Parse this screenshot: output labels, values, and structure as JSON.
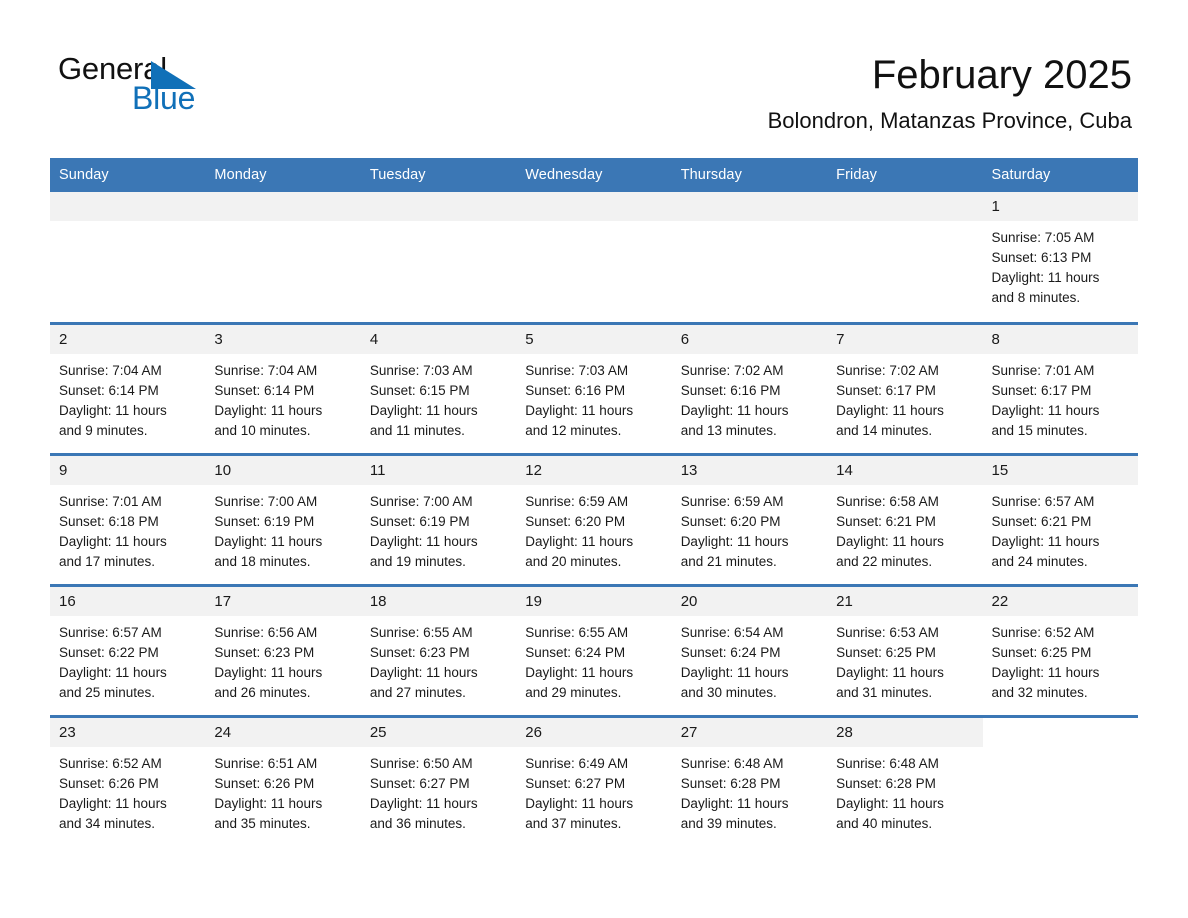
{
  "logo": {
    "word_one": "General",
    "word_two": "Blue",
    "triangle_icon": "blue-triangle-icon",
    "blue": "#1070b8"
  },
  "header": {
    "title": "February 2025",
    "subtitle": "Bolondron, Matanzas Province, Cuba"
  },
  "colors": {
    "header_blue": "#3b77b5",
    "row_divider_blue": "#3b77b5",
    "daynum_gray": "#f2f2f2",
    "text": "#1a1a1a"
  },
  "weekday_headers": [
    "Sunday",
    "Monday",
    "Tuesday",
    "Wednesday",
    "Thursday",
    "Friday",
    "Saturday"
  ],
  "weeks": [
    [
      {
        "day": "",
        "sunrise": "",
        "sunset": "",
        "daylight_line1": "",
        "daylight_line2": "",
        "blank": true
      },
      {
        "day": "",
        "sunrise": "",
        "sunset": "",
        "daylight_line1": "",
        "daylight_line2": "",
        "blank": true
      },
      {
        "day": "",
        "sunrise": "",
        "sunset": "",
        "daylight_line1": "",
        "daylight_line2": "",
        "blank": true
      },
      {
        "day": "",
        "sunrise": "",
        "sunset": "",
        "daylight_line1": "",
        "daylight_line2": "",
        "blank": true
      },
      {
        "day": "",
        "sunrise": "",
        "sunset": "",
        "daylight_line1": "",
        "daylight_line2": "",
        "blank": true
      },
      {
        "day": "",
        "sunrise": "",
        "sunset": "",
        "daylight_line1": "",
        "daylight_line2": "",
        "blank": true
      },
      {
        "day": "1",
        "sunrise": "Sunrise: 7:05 AM",
        "sunset": "Sunset: 6:13 PM",
        "daylight_line1": "Daylight: 11 hours",
        "daylight_line2": "and 8 minutes.",
        "blank": false
      }
    ],
    [
      {
        "day": "2",
        "sunrise": "Sunrise: 7:04 AM",
        "sunset": "Sunset: 6:14 PM",
        "daylight_line1": "Daylight: 11 hours",
        "daylight_line2": "and 9 minutes.",
        "blank": false
      },
      {
        "day": "3",
        "sunrise": "Sunrise: 7:04 AM",
        "sunset": "Sunset: 6:14 PM",
        "daylight_line1": "Daylight: 11 hours",
        "daylight_line2": "and 10 minutes.",
        "blank": false
      },
      {
        "day": "4",
        "sunrise": "Sunrise: 7:03 AM",
        "sunset": "Sunset: 6:15 PM",
        "daylight_line1": "Daylight: 11 hours",
        "daylight_line2": "and 11 minutes.",
        "blank": false
      },
      {
        "day": "5",
        "sunrise": "Sunrise: 7:03 AM",
        "sunset": "Sunset: 6:16 PM",
        "daylight_line1": "Daylight: 11 hours",
        "daylight_line2": "and 12 minutes.",
        "blank": false
      },
      {
        "day": "6",
        "sunrise": "Sunrise: 7:02 AM",
        "sunset": "Sunset: 6:16 PM",
        "daylight_line1": "Daylight: 11 hours",
        "daylight_line2": "and 13 minutes.",
        "blank": false
      },
      {
        "day": "7",
        "sunrise": "Sunrise: 7:02 AM",
        "sunset": "Sunset: 6:17 PM",
        "daylight_line1": "Daylight: 11 hours",
        "daylight_line2": "and 14 minutes.",
        "blank": false
      },
      {
        "day": "8",
        "sunrise": "Sunrise: 7:01 AM",
        "sunset": "Sunset: 6:17 PM",
        "daylight_line1": "Daylight: 11 hours",
        "daylight_line2": "and 15 minutes.",
        "blank": false
      }
    ],
    [
      {
        "day": "9",
        "sunrise": "Sunrise: 7:01 AM",
        "sunset": "Sunset: 6:18 PM",
        "daylight_line1": "Daylight: 11 hours",
        "daylight_line2": "and 17 minutes.",
        "blank": false
      },
      {
        "day": "10",
        "sunrise": "Sunrise: 7:00 AM",
        "sunset": "Sunset: 6:19 PM",
        "daylight_line1": "Daylight: 11 hours",
        "daylight_line2": "and 18 minutes.",
        "blank": false
      },
      {
        "day": "11",
        "sunrise": "Sunrise: 7:00 AM",
        "sunset": "Sunset: 6:19 PM",
        "daylight_line1": "Daylight: 11 hours",
        "daylight_line2": "and 19 minutes.",
        "blank": false
      },
      {
        "day": "12",
        "sunrise": "Sunrise: 6:59 AM",
        "sunset": "Sunset: 6:20 PM",
        "daylight_line1": "Daylight: 11 hours",
        "daylight_line2": "and 20 minutes.",
        "blank": false
      },
      {
        "day": "13",
        "sunrise": "Sunrise: 6:59 AM",
        "sunset": "Sunset: 6:20 PM",
        "daylight_line1": "Daylight: 11 hours",
        "daylight_line2": "and 21 minutes.",
        "blank": false
      },
      {
        "day": "14",
        "sunrise": "Sunrise: 6:58 AM",
        "sunset": "Sunset: 6:21 PM",
        "daylight_line1": "Daylight: 11 hours",
        "daylight_line2": "and 22 minutes.",
        "blank": false
      },
      {
        "day": "15",
        "sunrise": "Sunrise: 6:57 AM",
        "sunset": "Sunset: 6:21 PM",
        "daylight_line1": "Daylight: 11 hours",
        "daylight_line2": "and 24 minutes.",
        "blank": false
      }
    ],
    [
      {
        "day": "16",
        "sunrise": "Sunrise: 6:57 AM",
        "sunset": "Sunset: 6:22 PM",
        "daylight_line1": "Daylight: 11 hours",
        "daylight_line2": "and 25 minutes.",
        "blank": false
      },
      {
        "day": "17",
        "sunrise": "Sunrise: 6:56 AM",
        "sunset": "Sunset: 6:23 PM",
        "daylight_line1": "Daylight: 11 hours",
        "daylight_line2": "and 26 minutes.",
        "blank": false
      },
      {
        "day": "18",
        "sunrise": "Sunrise: 6:55 AM",
        "sunset": "Sunset: 6:23 PM",
        "daylight_line1": "Daylight: 11 hours",
        "daylight_line2": "and 27 minutes.",
        "blank": false
      },
      {
        "day": "19",
        "sunrise": "Sunrise: 6:55 AM",
        "sunset": "Sunset: 6:24 PM",
        "daylight_line1": "Daylight: 11 hours",
        "daylight_line2": "and 29 minutes.",
        "blank": false
      },
      {
        "day": "20",
        "sunrise": "Sunrise: 6:54 AM",
        "sunset": "Sunset: 6:24 PM",
        "daylight_line1": "Daylight: 11 hours",
        "daylight_line2": "and 30 minutes.",
        "blank": false
      },
      {
        "day": "21",
        "sunrise": "Sunrise: 6:53 AM",
        "sunset": "Sunset: 6:25 PM",
        "daylight_line1": "Daylight: 11 hours",
        "daylight_line2": "and 31 minutes.",
        "blank": false
      },
      {
        "day": "22",
        "sunrise": "Sunrise: 6:52 AM",
        "sunset": "Sunset: 6:25 PM",
        "daylight_line1": "Daylight: 11 hours",
        "daylight_line2": "and 32 minutes.",
        "blank": false
      }
    ],
    [
      {
        "day": "23",
        "sunrise": "Sunrise: 6:52 AM",
        "sunset": "Sunset: 6:26 PM",
        "daylight_line1": "Daylight: 11 hours",
        "daylight_line2": "and 34 minutes.",
        "blank": false
      },
      {
        "day": "24",
        "sunrise": "Sunrise: 6:51 AM",
        "sunset": "Sunset: 6:26 PM",
        "daylight_line1": "Daylight: 11 hours",
        "daylight_line2": "and 35 minutes.",
        "blank": false
      },
      {
        "day": "25",
        "sunrise": "Sunrise: 6:50 AM",
        "sunset": "Sunset: 6:27 PM",
        "daylight_line1": "Daylight: 11 hours",
        "daylight_line2": "and 36 minutes.",
        "blank": false
      },
      {
        "day": "26",
        "sunrise": "Sunrise: 6:49 AM",
        "sunset": "Sunset: 6:27 PM",
        "daylight_line1": "Daylight: 11 hours",
        "daylight_line2": "and 37 minutes.",
        "blank": false
      },
      {
        "day": "27",
        "sunrise": "Sunrise: 6:48 AM",
        "sunset": "Sunset: 6:28 PM",
        "daylight_line1": "Daylight: 11 hours",
        "daylight_line2": "and 39 minutes.",
        "blank": false
      },
      {
        "day": "28",
        "sunrise": "Sunrise: 6:48 AM",
        "sunset": "Sunset: 6:28 PM",
        "daylight_line1": "Daylight: 11 hours",
        "daylight_line2": "and 40 minutes.",
        "blank": false
      },
      {
        "day": "",
        "sunrise": "",
        "sunset": "",
        "daylight_line1": "",
        "daylight_line2": "",
        "blank": true
      }
    ]
  ]
}
